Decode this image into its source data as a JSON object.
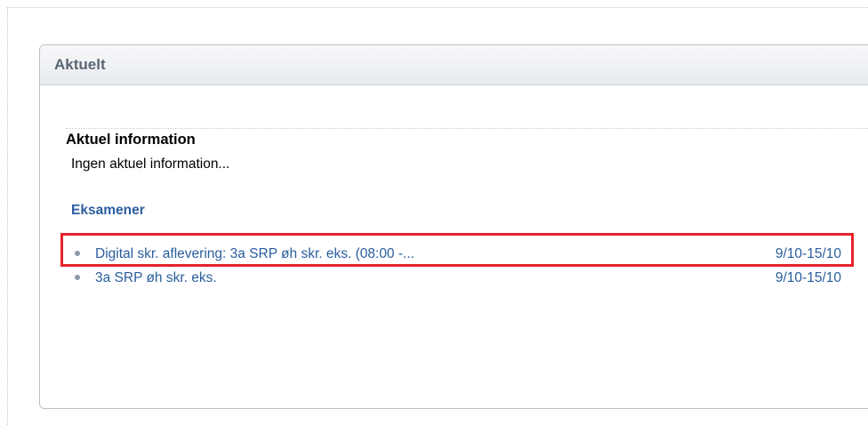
{
  "panel": {
    "title": "Aktuelt"
  },
  "info": {
    "heading": "Aktuel information",
    "text": "Ingen aktuel information..."
  },
  "exams": {
    "heading": "Eksamener",
    "items": [
      {
        "title": "Digital skr. aflevering: 3a SRP øh skr. eks. (08:00 -...",
        "date": "9/10-15/10",
        "highlighted": true
      },
      {
        "title": "3a SRP øh skr. eks.",
        "date": "9/10-15/10",
        "highlighted": false
      }
    ]
  },
  "colors": {
    "link": "#2a5d9e",
    "highlight": "#e8202a",
    "header_text": "#5a6670"
  }
}
